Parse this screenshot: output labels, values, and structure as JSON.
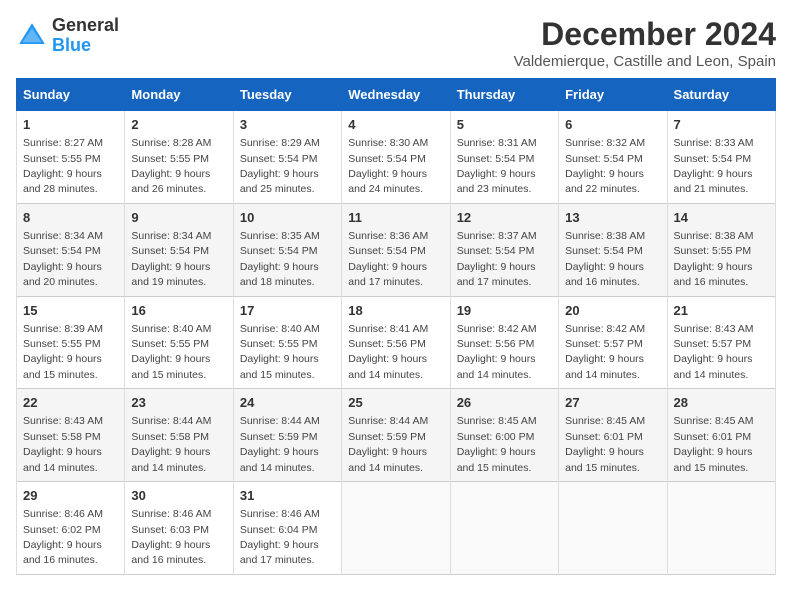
{
  "header": {
    "logo_general": "General",
    "logo_blue": "Blue",
    "month_title": "December 2024",
    "location": "Valdemierque, Castille and Leon, Spain"
  },
  "weekdays": [
    "Sunday",
    "Monday",
    "Tuesday",
    "Wednesday",
    "Thursday",
    "Friday",
    "Saturday"
  ],
  "weeks": [
    [
      {
        "day": "1",
        "info": "Sunrise: 8:27 AM\nSunset: 5:55 PM\nDaylight: 9 hours and 28 minutes."
      },
      {
        "day": "2",
        "info": "Sunrise: 8:28 AM\nSunset: 5:55 PM\nDaylight: 9 hours and 26 minutes."
      },
      {
        "day": "3",
        "info": "Sunrise: 8:29 AM\nSunset: 5:54 PM\nDaylight: 9 hours and 25 minutes."
      },
      {
        "day": "4",
        "info": "Sunrise: 8:30 AM\nSunset: 5:54 PM\nDaylight: 9 hours and 24 minutes."
      },
      {
        "day": "5",
        "info": "Sunrise: 8:31 AM\nSunset: 5:54 PM\nDaylight: 9 hours and 23 minutes."
      },
      {
        "day": "6",
        "info": "Sunrise: 8:32 AM\nSunset: 5:54 PM\nDaylight: 9 hours and 22 minutes."
      },
      {
        "day": "7",
        "info": "Sunrise: 8:33 AM\nSunset: 5:54 PM\nDaylight: 9 hours and 21 minutes."
      }
    ],
    [
      {
        "day": "8",
        "info": "Sunrise: 8:34 AM\nSunset: 5:54 PM\nDaylight: 9 hours and 20 minutes."
      },
      {
        "day": "9",
        "info": "Sunrise: 8:34 AM\nSunset: 5:54 PM\nDaylight: 9 hours and 19 minutes."
      },
      {
        "day": "10",
        "info": "Sunrise: 8:35 AM\nSunset: 5:54 PM\nDaylight: 9 hours and 18 minutes."
      },
      {
        "day": "11",
        "info": "Sunrise: 8:36 AM\nSunset: 5:54 PM\nDaylight: 9 hours and 17 minutes."
      },
      {
        "day": "12",
        "info": "Sunrise: 8:37 AM\nSunset: 5:54 PM\nDaylight: 9 hours and 17 minutes."
      },
      {
        "day": "13",
        "info": "Sunrise: 8:38 AM\nSunset: 5:54 PM\nDaylight: 9 hours and 16 minutes."
      },
      {
        "day": "14",
        "info": "Sunrise: 8:38 AM\nSunset: 5:55 PM\nDaylight: 9 hours and 16 minutes."
      }
    ],
    [
      {
        "day": "15",
        "info": "Sunrise: 8:39 AM\nSunset: 5:55 PM\nDaylight: 9 hours and 15 minutes."
      },
      {
        "day": "16",
        "info": "Sunrise: 8:40 AM\nSunset: 5:55 PM\nDaylight: 9 hours and 15 minutes."
      },
      {
        "day": "17",
        "info": "Sunrise: 8:40 AM\nSunset: 5:55 PM\nDaylight: 9 hours and 15 minutes."
      },
      {
        "day": "18",
        "info": "Sunrise: 8:41 AM\nSunset: 5:56 PM\nDaylight: 9 hours and 14 minutes."
      },
      {
        "day": "19",
        "info": "Sunrise: 8:42 AM\nSunset: 5:56 PM\nDaylight: 9 hours and 14 minutes."
      },
      {
        "day": "20",
        "info": "Sunrise: 8:42 AM\nSunset: 5:57 PM\nDaylight: 9 hours and 14 minutes."
      },
      {
        "day": "21",
        "info": "Sunrise: 8:43 AM\nSunset: 5:57 PM\nDaylight: 9 hours and 14 minutes."
      }
    ],
    [
      {
        "day": "22",
        "info": "Sunrise: 8:43 AM\nSunset: 5:58 PM\nDaylight: 9 hours and 14 minutes."
      },
      {
        "day": "23",
        "info": "Sunrise: 8:44 AM\nSunset: 5:58 PM\nDaylight: 9 hours and 14 minutes."
      },
      {
        "day": "24",
        "info": "Sunrise: 8:44 AM\nSunset: 5:59 PM\nDaylight: 9 hours and 14 minutes."
      },
      {
        "day": "25",
        "info": "Sunrise: 8:44 AM\nSunset: 5:59 PM\nDaylight: 9 hours and 14 minutes."
      },
      {
        "day": "26",
        "info": "Sunrise: 8:45 AM\nSunset: 6:00 PM\nDaylight: 9 hours and 15 minutes."
      },
      {
        "day": "27",
        "info": "Sunrise: 8:45 AM\nSunset: 6:01 PM\nDaylight: 9 hours and 15 minutes."
      },
      {
        "day": "28",
        "info": "Sunrise: 8:45 AM\nSunset: 6:01 PM\nDaylight: 9 hours and 15 minutes."
      }
    ],
    [
      {
        "day": "29",
        "info": "Sunrise: 8:46 AM\nSunset: 6:02 PM\nDaylight: 9 hours and 16 minutes."
      },
      {
        "day": "30",
        "info": "Sunrise: 8:46 AM\nSunset: 6:03 PM\nDaylight: 9 hours and 16 minutes."
      },
      {
        "day": "31",
        "info": "Sunrise: 8:46 AM\nSunset: 6:04 PM\nDaylight: 9 hours and 17 minutes."
      },
      null,
      null,
      null,
      null
    ]
  ]
}
